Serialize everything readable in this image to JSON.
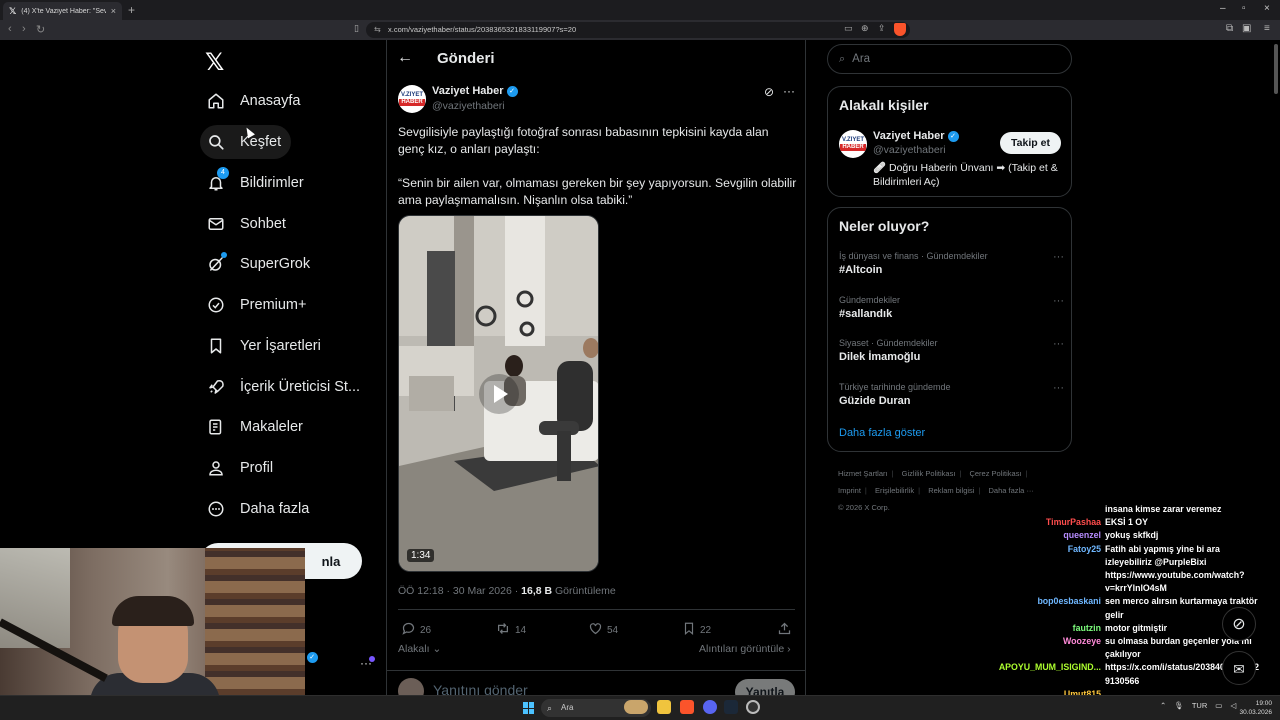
{
  "browser": {
    "tab_title": "(4) X'te Vaziyet Haber: \"Sevgilisiyle",
    "url": "x.com/vaziyethaber/status/2038365321833119907?s=20"
  },
  "nav": {
    "items": [
      {
        "label": "Anasayfa",
        "icon": "home-icon"
      },
      {
        "label": "Keşfet",
        "icon": "search-icon"
      },
      {
        "label": "Bildirimler",
        "icon": "bell-icon",
        "badge": "4"
      },
      {
        "label": "Sohbet",
        "icon": "mail-icon"
      },
      {
        "label": "SuperGrok",
        "icon": "grok-icon"
      },
      {
        "label": "Premium+",
        "icon": "verified-icon"
      },
      {
        "label": "Yer İşaretleri",
        "icon": "bookmark-icon"
      },
      {
        "label": "İçerik Üreticisi St...",
        "icon": "rocket-icon"
      },
      {
        "label": "Makaleler",
        "icon": "article-icon"
      },
      {
        "label": "Profil",
        "icon": "person-icon"
      },
      {
        "label": "Daha fazla",
        "icon": "more-circle-icon"
      }
    ],
    "post_button": "nla",
    "account_suffix": "i"
  },
  "post": {
    "header_title": "Gönderi",
    "author_name": "Vaziyet Haber",
    "author_handle": "@vaziyethaberi",
    "avatar_line1": "V.ZIYET",
    "avatar_line2": "HABER",
    "text_p1": "Sevgilisiyle paylaştığı fotoğraf sonrası babasının tepkisini kayda alan genç kız, o anları paylaştı:",
    "text_p2": "“Senin bir ailen var, olmaması gereken bir şey yapıyorsun. Sevgilin olabilir ama paylaşmamalısın. Nişanlın olsa tabiki.”",
    "video_duration": "1:34",
    "timestamp": "ÖÖ 12:18 · 30 Mar 2026 · ",
    "views_count": "16,8 B",
    "views_label": " Görüntüleme",
    "replies": "26",
    "reposts": "14",
    "likes": "54",
    "bookmarks": "22",
    "relevance_label": "Alakalı",
    "quotes_label": "Alıntıları görüntüle",
    "reply_placeholder": "Yanıtını gönder",
    "reply_button": "Yanıtla"
  },
  "right": {
    "search_placeholder": "Ara",
    "related_title": "Alakalı kişiler",
    "related_name": "Vaziyet Haber",
    "related_handle": "@vaziyethaberi",
    "related_bio": "🩹 Doğru Haberin Ünvanı ➡ (Takip et & Bildirimleri Aç)",
    "follow_button": "Takip et",
    "trends_title": "Neler oluyor?",
    "trends": [
      {
        "category": "İş dünyası ve finans · Gündemdekiler",
        "name": "#Altcoin"
      },
      {
        "category": "Gündemdekiler",
        "name": "#sallandık"
      },
      {
        "category": "Siyaset · Gündemdekiler",
        "name": "Dilek İmamoğlu"
      },
      {
        "category": "Türkiye tarihinde gündemde",
        "name": "Güzide Duran"
      }
    ],
    "show_more": "Daha fazla göster",
    "footer_links": [
      "Hizmet Şartları",
      "Gizlilik Politikası",
      "Çerez Politikası",
      "Imprint",
      "Erişilebilirlik",
      "Reklam bilgisi",
      "Daha fazla ···"
    ],
    "copyright": "© 2026 X Corp."
  },
  "chat": [
    {
      "user": "",
      "color": "#ffffff",
      "msg": "insana kimse zarar veremez"
    },
    {
      "user": "TimurPashaa",
      "color": "#ff4d4d",
      "msg": "EKSİ 1 OY"
    },
    {
      "user": "queenzel",
      "color": "#b78cff",
      "msg": "yokuş skfkdj"
    },
    {
      "user": "Fatoy25",
      "color": "#6fb7ff",
      "msg": "Fatih abi yapmış yine bi ara izleyebiliriz @PurpleBixi https://www.youtube.com/watch?v=krrYlnlO4sM"
    },
    {
      "user": "bop0esbaskani",
      "color": "#6fb7ff",
      "msg": "sen merco alırsın kurtarmaya traktör gelir"
    },
    {
      "user": "fautzin",
      "color": "#7cfc7c",
      "msg": "motor gitmiştir"
    },
    {
      "user": "Woozeye",
      "color": "#ff8ad8",
      "msg": "su olmasa burdan geçenler yola mı çakılıyor"
    },
    {
      "user": "APOYU_MUM_ISIGIND...",
      "color": "#adff2f",
      "msg": "https://x.com/i/status/2038404409782 9130566"
    },
    {
      "user": "Umut815",
      "color": "#ffc83d",
      "msg": ""
    }
  ],
  "taskbar": {
    "search": "Ara",
    "lang": "TUR",
    "time": "19:00",
    "date": "30.03.2026"
  },
  "colors": {
    "accent": "#1d9bf0",
    "background": "#000000",
    "border": "#2f3336"
  }
}
